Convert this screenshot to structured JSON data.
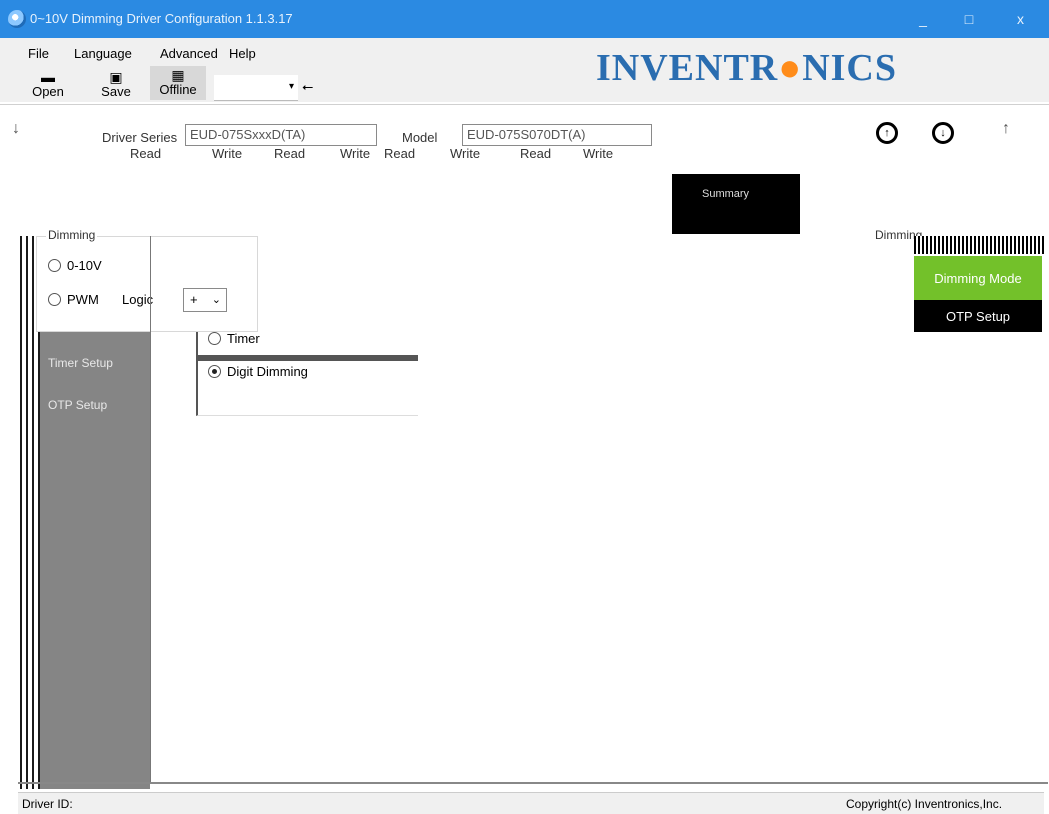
{
  "window": {
    "title": "0~10V Dimming Driver Configuration 1.1.3.17",
    "min": "_",
    "max": "□",
    "close": "x"
  },
  "menu": {
    "file": "File",
    "language": "Language",
    "advanced": "Advanced",
    "help": "Help"
  },
  "toolbar": {
    "open": "Open",
    "save": "Save",
    "offline": "Offline",
    "combo_arrow": "▾",
    "usb": "⭠"
  },
  "logo": {
    "part1": "INVENTR",
    "part2": "●",
    "part3": "NICS"
  },
  "driver_info": {
    "series_label": "Driver Series",
    "series_value": "EUD-075SxxxD(TA)",
    "model_label": "Model",
    "model_value": "EUD-075S070DT(A)",
    "read": "Read",
    "write": "Write",
    "upload_glyph": "↑",
    "download_glyph": "↓"
  },
  "sidebar": {
    "timer_setup": "Timer Setup",
    "otp_setup": "OTP Setup"
  },
  "dimming_group": {
    "legend": "Dimming",
    "opt_010v": "0-10V",
    "opt_pwm": "PWM",
    "logic_label": "Logic",
    "logic_value": "+",
    "opt_timer": "Timer",
    "opt_digit": "Digit Dimming"
  },
  "nav": {
    "summary": "Summary",
    "dimming_label": "Dimming",
    "dimming_mode": "Dimming Mode",
    "otp_setup": "OTP Setup"
  },
  "status": {
    "driver_id": "Driver ID:",
    "copyright": "Copyright(c) Inventronics,Inc."
  },
  "colors": {
    "title_bar": "#2b8ae2",
    "logo": "#2a6db0",
    "nav_active": "#73c12a"
  }
}
